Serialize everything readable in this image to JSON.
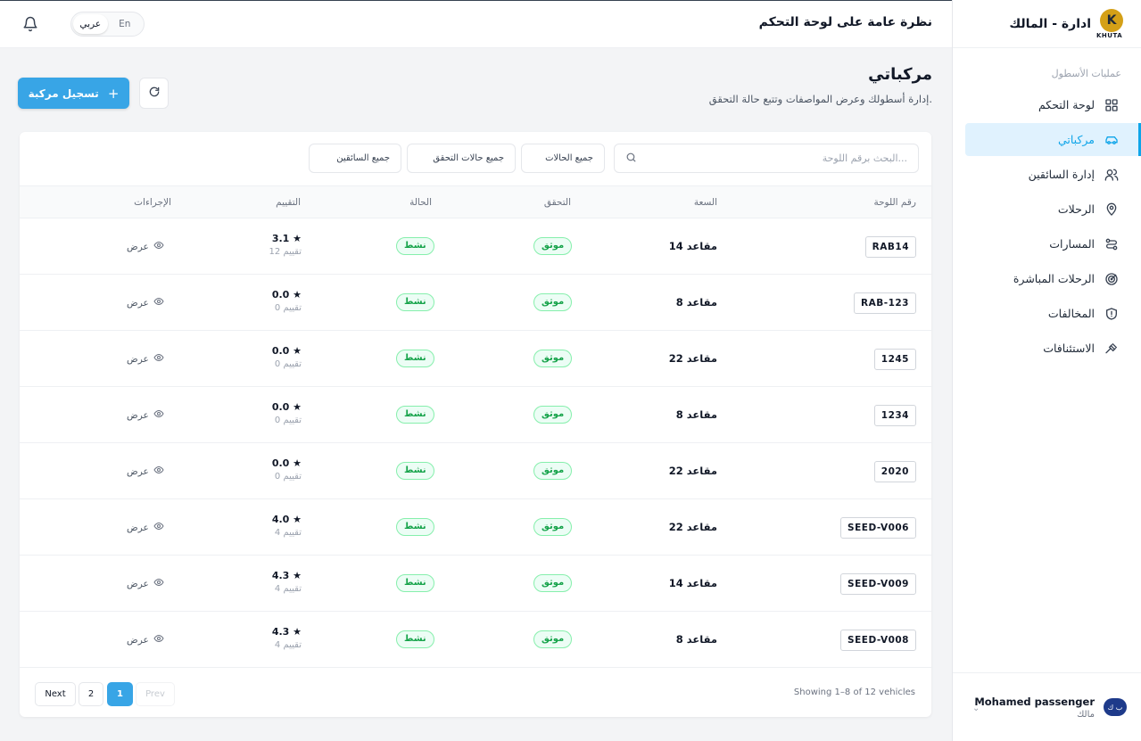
{
  "header": {
    "title": "نظرة عامة على لوحة التحكم",
    "lang_en": "En",
    "lang_ar": "عربي"
  },
  "sidebar": {
    "brand_title": "ادارة - المالك",
    "logo_text": "KHUTA",
    "section_label": "عمليات الأسطول",
    "items": [
      {
        "label": "لوحة التحكم",
        "icon": "grid-icon"
      },
      {
        "label": "مركباتي",
        "icon": "car-icon"
      },
      {
        "label": "إدارة السائقين",
        "icon": "users-icon"
      },
      {
        "label": "الرحلات",
        "icon": "map-pin-icon"
      },
      {
        "label": "المسارات",
        "icon": "route-icon"
      },
      {
        "label": "الرحلات المباشرة",
        "icon": "radar-icon"
      },
      {
        "label": "المخالفات",
        "icon": "shield-alert-icon"
      },
      {
        "label": "الاستئنافات",
        "icon": "gavel-icon"
      }
    ],
    "user": {
      "name": "Mohamed passenger",
      "role": "مالك",
      "avatar": "ب ك"
    }
  },
  "page": {
    "title": "مركباتي",
    "subtitle": "إدارة أسطولك وعرض المواصفات وتتبع حالة التحقق.",
    "add_button": "تسجيل مركبة"
  },
  "filters": {
    "search_placeholder": "البحث برقم اللوحة...",
    "status": "جميع الحالات",
    "verification": "جميع حالات التحقق",
    "drivers": "جميع السائقين"
  },
  "table": {
    "headers": {
      "plate": "رقم اللوحة",
      "capacity": "السعة",
      "verification": "التحقق",
      "status": "الحالة",
      "rating": "التقييم",
      "actions": "الإجراءات"
    },
    "rows": [
      {
        "plate": "RAB14",
        "capacity": "14 مقاعد",
        "verification": "موثق",
        "status": "نشط",
        "rating": "3.1 ★",
        "reviews": "12 تقييم",
        "action": "عرض"
      },
      {
        "plate": "RAB-123",
        "capacity": "8 مقاعد",
        "verification": "موثق",
        "status": "نشط",
        "rating": "0.0 ★",
        "reviews": "0 تقييم",
        "action": "عرض"
      },
      {
        "plate": "1245",
        "capacity": "22 مقاعد",
        "verification": "موثق",
        "status": "نشط",
        "rating": "0.0 ★",
        "reviews": "0 تقييم",
        "action": "عرض"
      },
      {
        "plate": "1234",
        "capacity": "8 مقاعد",
        "verification": "موثق",
        "status": "نشط",
        "rating": "0.0 ★",
        "reviews": "0 تقييم",
        "action": "عرض"
      },
      {
        "plate": "2020",
        "capacity": "22 مقاعد",
        "verification": "موثق",
        "status": "نشط",
        "rating": "0.0 ★",
        "reviews": "0 تقييم",
        "action": "عرض"
      },
      {
        "plate": "SEED-V006",
        "capacity": "22 مقاعد",
        "verification": "موثق",
        "status": "نشط",
        "rating": "4.0 ★",
        "reviews": "4 تقييم",
        "action": "عرض"
      },
      {
        "plate": "SEED-V009",
        "capacity": "14 مقاعد",
        "verification": "موثق",
        "status": "نشط",
        "rating": "4.3 ★",
        "reviews": "4 تقييم",
        "action": "عرض"
      },
      {
        "plate": "SEED-V008",
        "capacity": "8 مقاعد",
        "verification": "موثق",
        "status": "نشط",
        "rating": "4.3 ★",
        "reviews": "4 تقييم",
        "action": "عرض"
      }
    ]
  },
  "pagination": {
    "showing": "Showing 1–8 of 12 vehicles",
    "prev": "Prev",
    "page1": "1",
    "page2": "2",
    "next": "Next"
  },
  "colors": {
    "accent": "#38a5e6",
    "active_nav": "#0ea5e9",
    "success": "#16a34a"
  }
}
